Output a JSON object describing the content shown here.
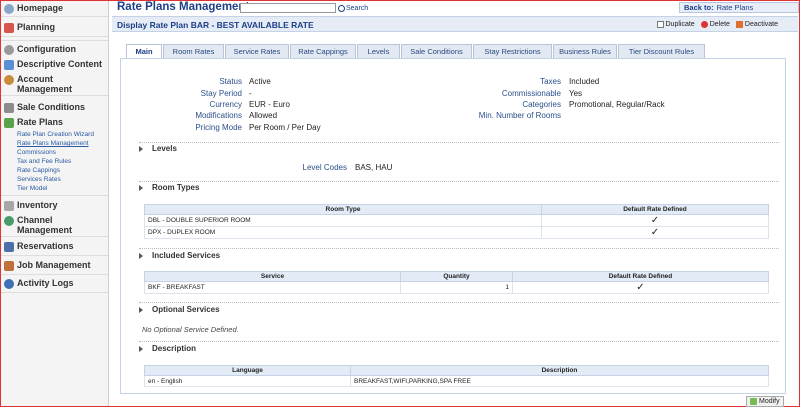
{
  "sidebar": {
    "homepage": "Homepage",
    "planning": "Planning",
    "configuration": "Configuration",
    "descriptive_content": "Descriptive Content",
    "account_management": "Account Management",
    "sale_conditions": "Sale Conditions",
    "rate_plans": "Rate Plans",
    "rate_plans_subitems": [
      "Rate Plan Creation Wizard",
      "Rate Plans Management",
      "Commissions",
      "Tax and Fee Rules",
      "Rate Cappings",
      "Services Rates",
      "Tier Model"
    ],
    "inventory": "Inventory",
    "channel_management": "Channel Management",
    "reservations": "Reservations",
    "job_management": "Job Management",
    "activity_logs": "Activity Logs"
  },
  "header": {
    "title": "Rate Plans Management",
    "search_value": "",
    "search_label": "Search",
    "back_to_label": "Back to:",
    "back_to_target": "Rate Plans"
  },
  "page": {
    "title": "Display Rate Plan BAR - BEST AVAILABLE RATE",
    "actions": {
      "duplicate": "Duplicate",
      "delete": "Delete",
      "deactivate": "Deactivate"
    }
  },
  "tabs": [
    "Main",
    "Room Rates",
    "Service Rates",
    "Rate Cappings",
    "Levels",
    "Sale Conditions",
    "Stay Restrictions",
    "Business Rules",
    "Tier Discount Rules"
  ],
  "main": {
    "left": [
      {
        "label": "Status",
        "value": "Active"
      },
      {
        "label": "Stay Period",
        "value": "-"
      },
      {
        "label": "Currency",
        "value": "EUR - Euro"
      },
      {
        "label": "Modifications",
        "value": "Allowed"
      },
      {
        "label": "Pricing Mode",
        "value": "Per Room / Per Day"
      }
    ],
    "right": [
      {
        "label": "Taxes",
        "value": "Included"
      },
      {
        "label": "Commissionable",
        "value": "Yes"
      },
      {
        "label": "Categories",
        "value": "Promotional, Regular/Rack"
      },
      {
        "label": "Min. Number of Rooms",
        "value": ""
      }
    ]
  },
  "levels": {
    "heading": "Levels",
    "label": "Level Codes",
    "value": "BAS, HAU"
  },
  "room_types": {
    "heading": "Room Types",
    "columns": [
      "Room Type",
      "Default Rate Defined"
    ],
    "rows": [
      {
        "room": "DBL - DOUBLE SUPERIOR ROOM",
        "default": "✓"
      },
      {
        "room": "DPX - DUPLEX ROOM",
        "default": "✓"
      }
    ]
  },
  "included_services": {
    "heading": "Included Services",
    "columns": [
      "Service",
      "Quantity",
      "Default Rate Defined"
    ],
    "rows": [
      {
        "service": "BKF - BREAKFAST",
        "quantity": "1",
        "default": "✓"
      }
    ]
  },
  "optional_services": {
    "heading": "Optional Services",
    "empty_text": "No Optional Service Defined."
  },
  "description": {
    "heading": "Description",
    "columns": [
      "Language",
      "Description"
    ],
    "rows": [
      {
        "language": "en - English",
        "text": "BREAKFAST,WIFI,PARKING,SPA FREE"
      }
    ]
  },
  "footer": {
    "modify": "Modify"
  }
}
